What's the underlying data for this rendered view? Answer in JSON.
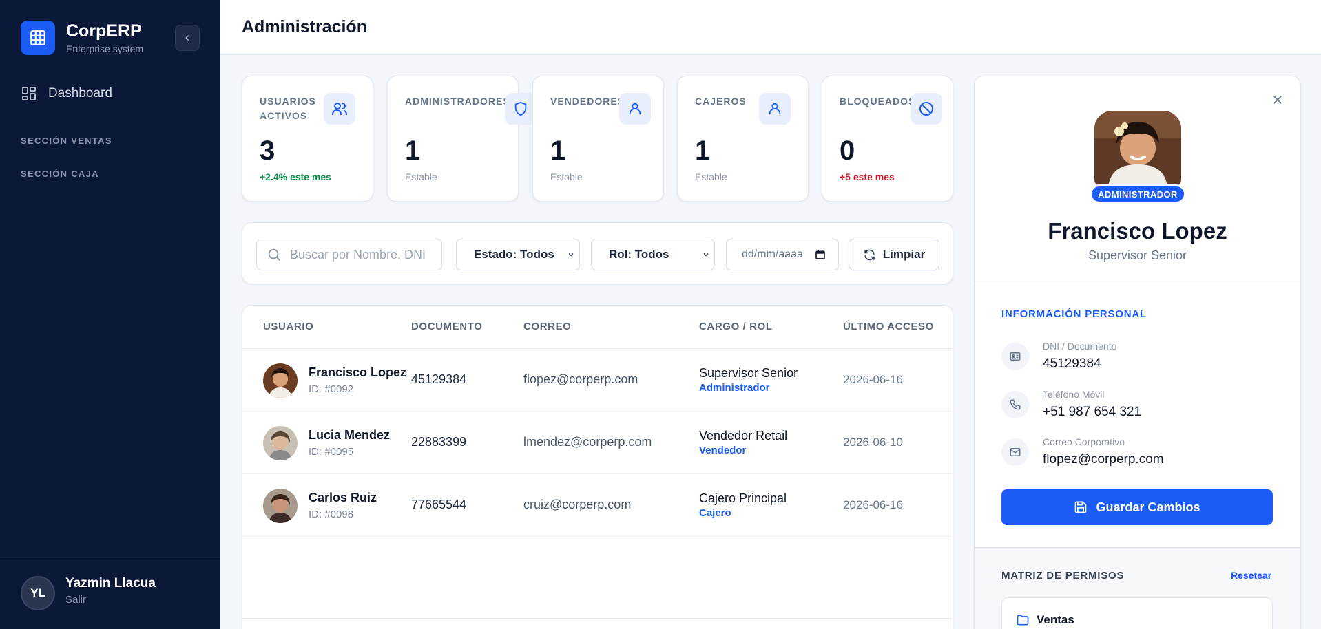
{
  "brand": {
    "name": "CorpERP",
    "subtitle": "Enterprise system"
  },
  "sidebar": {
    "nav": [
      {
        "label": "Dashboard",
        "icon": "dashboard-grid-icon"
      }
    ],
    "sections": [
      "SECCIÓN VENTAS",
      "SECCIÓN CAJA"
    ],
    "user": {
      "initials": "YL",
      "name": "Yazmin Llacua",
      "action": "Salir"
    }
  },
  "header": {
    "title": "Administración"
  },
  "stats": [
    {
      "label": "USUARIOS ACTIVOS",
      "value": "3",
      "sub": "+2.4% este mes",
      "sub_tone": "green",
      "icon": "users-icon"
    },
    {
      "label": "ADMINISTRADORES",
      "value": "1",
      "sub": "Estable",
      "sub_tone": "neutral",
      "icon": "shield-icon"
    },
    {
      "label": "VENDEDORES",
      "value": "1",
      "sub": "Estable",
      "sub_tone": "neutral",
      "icon": "user-icon"
    },
    {
      "label": "CAJEROS",
      "value": "1",
      "sub": "Estable",
      "sub_tone": "neutral",
      "icon": "user-icon"
    },
    {
      "label": "BLOQUEADOS",
      "value": "0",
      "sub": "+5 este mes",
      "sub_tone": "red",
      "icon": "block-icon"
    }
  ],
  "filters": {
    "search_placeholder": "Buscar por Nombre, DNI",
    "estado": "Estado: Todos",
    "rol": "Rol: Todos",
    "date_placeholder": "dd/mm/aaaa",
    "clear_label": "Limpiar"
  },
  "table": {
    "columns": [
      "USUARIO",
      "DOCUMENTO",
      "CORREO",
      "CARGO / ROL",
      "ÚLTIMO ACCESO"
    ],
    "rows": [
      {
        "name": "Francisco Lopez",
        "id": "ID: #0092",
        "doc": "45129384",
        "email": "flopez@corperp.com",
        "cargo": "Supervisor Senior",
        "rol": "Administrador",
        "last": "2026-06-16"
      },
      {
        "name": "Lucia Mendez",
        "id": "ID: #0095",
        "doc": "22883399",
        "email": "lmendez@corperp.com",
        "cargo": "Vendedor Retail",
        "rol": "Vendedor",
        "last": "2026-06-10"
      },
      {
        "name": "Carlos Ruiz",
        "id": "ID: #0098",
        "doc": "77665544",
        "email": "cruiz@corperp.com",
        "cargo": "Cajero Principal",
        "rol": "Cajero",
        "last": "2026-06-16"
      }
    ]
  },
  "profile": {
    "badge": "ADMINISTRADOR",
    "name": "Francisco Lopez",
    "title": "Supervisor Senior",
    "section_personal": "INFORMACIÓN PERSONAL",
    "fields": [
      {
        "label": "DNI / Documento",
        "value": "45129384",
        "icon": "id-card-icon"
      },
      {
        "label": "Teléfono Móvil",
        "value": "+51 987 654 321",
        "icon": "phone-icon"
      },
      {
        "label": "Correo Corporativo",
        "value": "flopez@corperp.com",
        "icon": "mail-icon"
      }
    ],
    "save_label": "Guardar Cambios",
    "permissions_title": "MATRIZ DE PERMISOS",
    "reset_label": "Resetear",
    "permission_groups": [
      {
        "label": "Ventas",
        "icon": "folder-icon"
      }
    ]
  },
  "colors": {
    "sidebar": "#0c1838",
    "accent": "#1a5cf5",
    "positive": "#0a8a4a",
    "negative": "#c81e2c"
  }
}
